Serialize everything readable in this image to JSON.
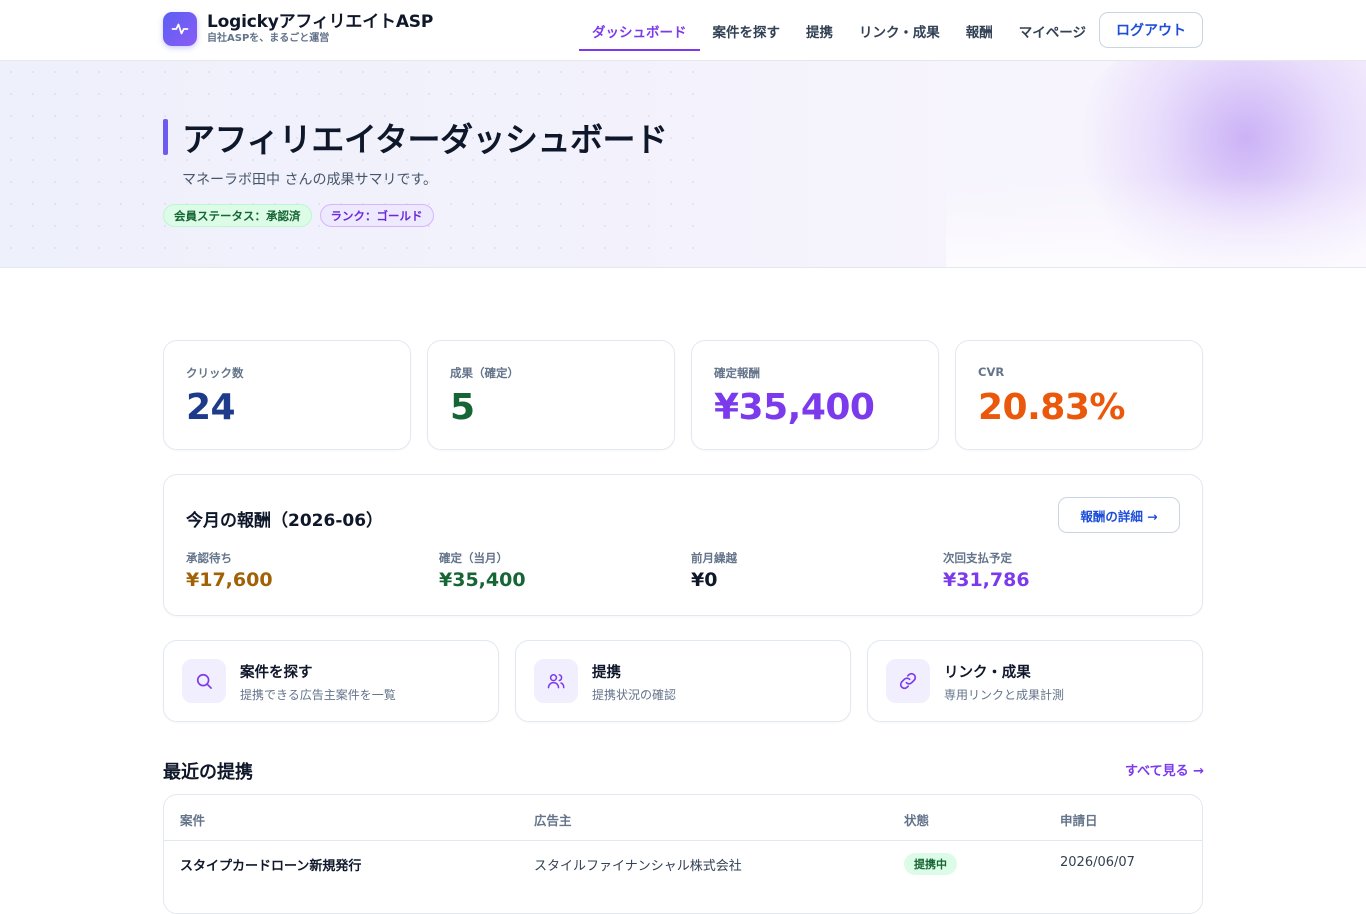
{
  "header": {
    "brand_title": "LogickyアフィリエイトASP",
    "brand_subtitle": "自社ASPを、まるごと運営",
    "nav": [
      {
        "label": "ダッシュボード",
        "active": true
      },
      {
        "label": "案件を探す",
        "active": false
      },
      {
        "label": "提携",
        "active": false
      },
      {
        "label": "リンク・成果",
        "active": false
      },
      {
        "label": "報酬",
        "active": false
      },
      {
        "label": "マイページ",
        "active": false
      }
    ],
    "logout_label": "ログアウト"
  },
  "hero": {
    "title": "アフィリエイターダッシュボード",
    "subtitle": "マネーラボ田中 さんの成果サマリです。",
    "badges": {
      "status": "会員ステータス：承認済",
      "rank": "ランク：ゴールド"
    }
  },
  "stats": [
    {
      "label": "クリック数",
      "value": "24",
      "color": "#1e3a8a"
    },
    {
      "label": "成果（確定）",
      "value": "5",
      "color": "#166534"
    },
    {
      "label": "確定報酬",
      "value": "¥35,400",
      "color": "#7c3aed"
    },
    {
      "label": "CVR",
      "value": "20.83%",
      "color": "#ea580c"
    }
  ],
  "monthly": {
    "title": "今月の報酬（2026-06）",
    "detail_button": "報酬の詳細 →",
    "items": [
      {
        "label": "承認待ち",
        "value": "¥17,600",
        "color": "#a16207"
      },
      {
        "label": "確定（当月）",
        "value": "¥35,400",
        "color": "#166534"
      },
      {
        "label": "前月繰越",
        "value": "¥0",
        "color": "#0f172a"
      },
      {
        "label": "次回支払予定",
        "value": "¥31,786",
        "color": "#7c3aed"
      }
    ]
  },
  "shortcuts": [
    {
      "title": "案件を探す",
      "desc": "提携できる広告主案件を一覧",
      "icon": "search-icon"
    },
    {
      "title": "提携",
      "desc": "提携状況の確認",
      "icon": "users-icon"
    },
    {
      "title": "リンク・成果",
      "desc": "専用リンクと成果計測",
      "icon": "link-icon"
    }
  ],
  "recent": {
    "title": "最近の提携",
    "see_all": "すべて見る →",
    "columns": [
      "案件",
      "広告主",
      "状態",
      "申請日"
    ],
    "rows": [
      {
        "campaign": "スタイプカードローン新規発行",
        "advertiser": "スタイルファイナンシャル株式会社",
        "status": "提携中",
        "date": "2026/06/07"
      }
    ]
  },
  "colors": {
    "accent": "#7c3aed",
    "link_blue": "#1d4ed8"
  }
}
